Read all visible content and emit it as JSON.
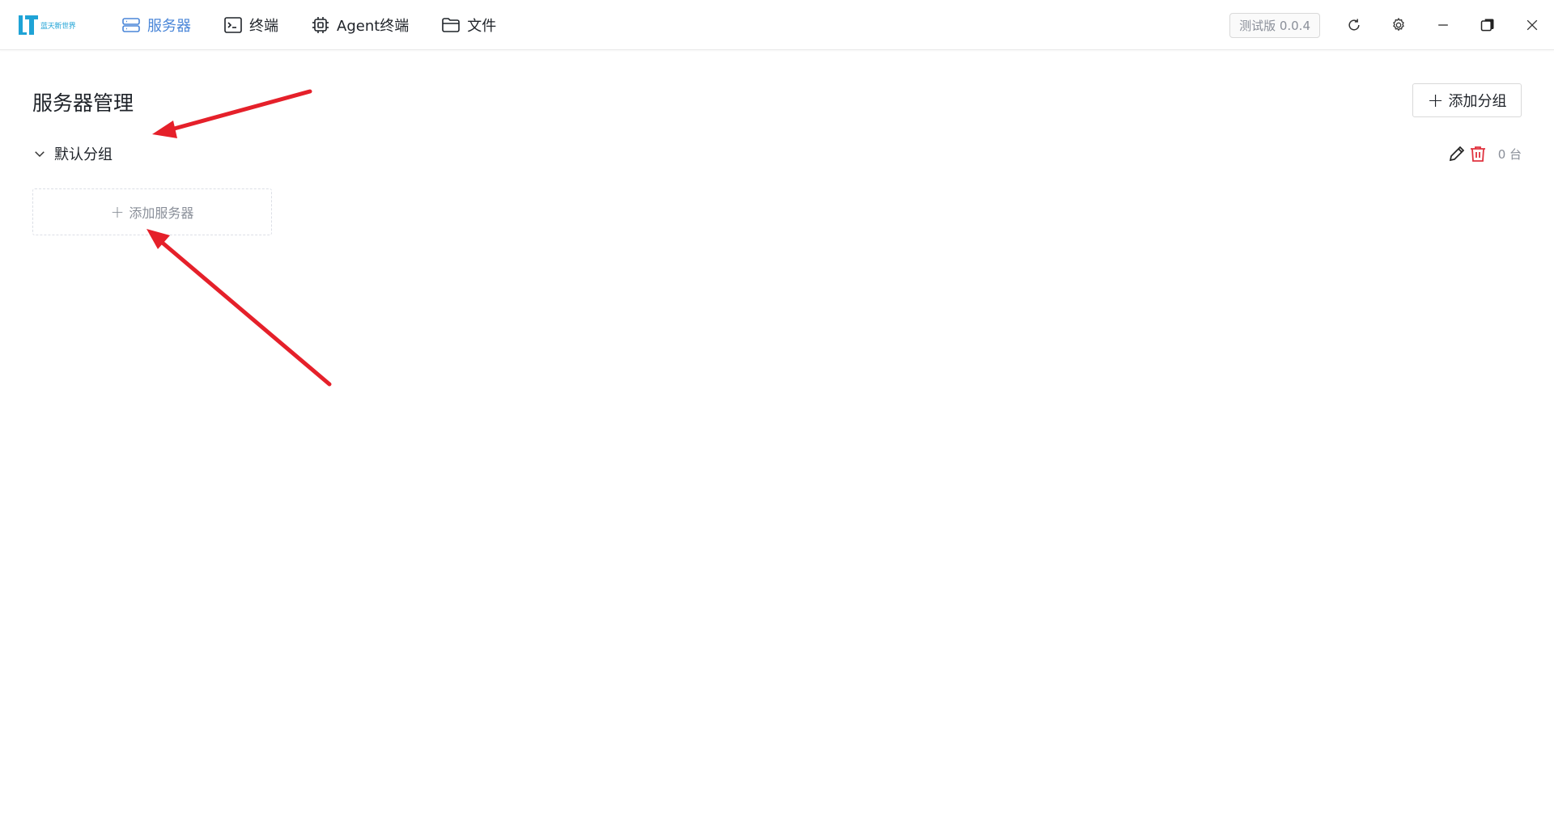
{
  "app": {
    "logo_text": "蓝天新世界",
    "colors": {
      "accent": "#4a86d8",
      "danger": "#e0323e",
      "annotation": "#e5202a"
    }
  },
  "nav": {
    "items": [
      {
        "label": "服务器",
        "icon": "server-icon",
        "active": true
      },
      {
        "label": "终端",
        "icon": "terminal-icon",
        "active": false
      },
      {
        "label": "Agent终端",
        "icon": "chip-icon",
        "active": false
      },
      {
        "label": "文件",
        "icon": "folder-icon",
        "active": false
      }
    ]
  },
  "toolbar": {
    "version": "测试版 0.0.4",
    "icons": [
      "refresh-icon",
      "gear-icon",
      "minimize-icon",
      "restore-icon",
      "close-icon"
    ]
  },
  "main": {
    "title": "服务器管理",
    "add_group_label": "添加分组",
    "groups": [
      {
        "name": "默认分组",
        "count_label": "0 台",
        "add_server_label": "添加服务器"
      }
    ]
  }
}
